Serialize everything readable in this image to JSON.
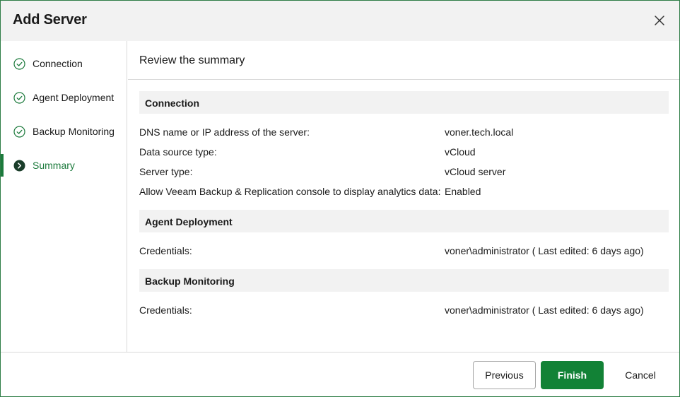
{
  "dialog": {
    "title": "Add Server"
  },
  "sidebar": {
    "steps": [
      {
        "label": "Connection",
        "state": "completed"
      },
      {
        "label": "Agent Deployment",
        "state": "completed"
      },
      {
        "label": "Backup Monitoring",
        "state": "completed"
      },
      {
        "label": "Summary",
        "state": "active"
      }
    ]
  },
  "main": {
    "title": "Review the summary",
    "sections": [
      {
        "header": "Connection",
        "rows": [
          {
            "label": "DNS name or IP address of the server:",
            "value": "voner.tech.local"
          },
          {
            "label": "Data source type:",
            "value": "vCloud"
          },
          {
            "label": "Server type:",
            "value": "vCloud server"
          },
          {
            "label": "Allow Veeam Backup & Replication console to display analytics data:",
            "value": "Enabled"
          }
        ]
      },
      {
        "header": "Agent Deployment",
        "rows": [
          {
            "label": "Credentials:",
            "value": "voner\\administrator ( Last edited: 6 days ago)"
          }
        ]
      },
      {
        "header": "Backup Monitoring",
        "rows": [
          {
            "label": "Credentials:",
            "value": "voner\\administrator ( Last edited: 6 days ago)"
          }
        ]
      }
    ]
  },
  "footer": {
    "previous_label": "Previous",
    "finish_label": "Finish",
    "cancel_label": "Cancel"
  },
  "colors": {
    "accent": "#128236",
    "active_text": "#1c7a3c",
    "header_bg": "#f2f2f2",
    "border": "#2e7d46"
  },
  "icons": {
    "close": "close-icon",
    "completed_step": "check-circle-icon",
    "active_step": "chevron-circle-icon"
  }
}
